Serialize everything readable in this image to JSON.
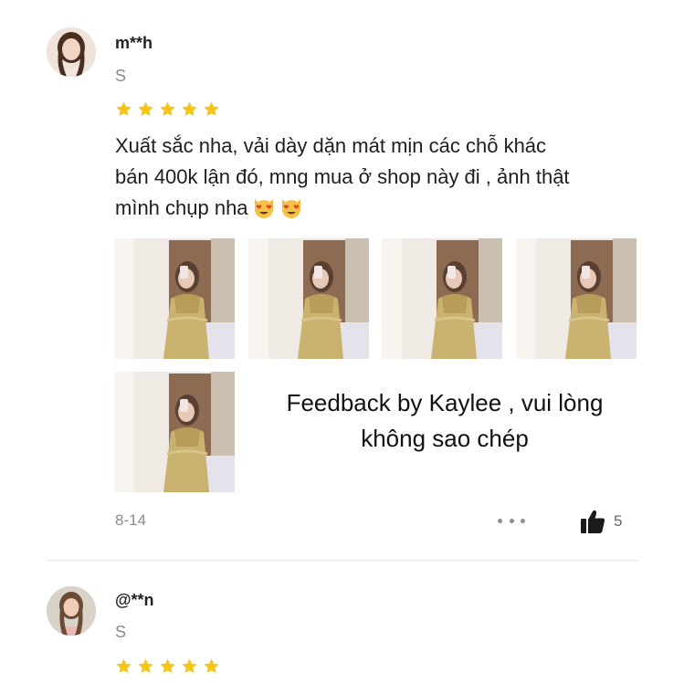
{
  "reviews": [
    {
      "username": "m**h",
      "variant": "S",
      "rating": 5,
      "text_lines": [
        "Xuất sắc nha, vải dày dặn mát mịn các chỗ khác",
        "bán 400k lận đó, mng mua ở shop này đi , ảnh thật",
        "mình chụp nha"
      ],
      "emojis": [
        "heart-eyes-cat-emoji",
        "heart-eyes-cat-emoji"
      ],
      "photo_count": 5,
      "watermark_lines": [
        "Feedback by Kaylee , vui lòng",
        "không sao chép"
      ],
      "date": "8-14",
      "likes": "5"
    },
    {
      "username": "@**n",
      "variant": "S",
      "rating": 5
    }
  ],
  "colors": {
    "star": "#f5c518",
    "text": "#1e1e1e",
    "muted": "#8c8c8c",
    "divider": "#e6e6e6"
  },
  "icons": {
    "more": "more-dots-icon",
    "like": "thumbs-up-icon"
  }
}
